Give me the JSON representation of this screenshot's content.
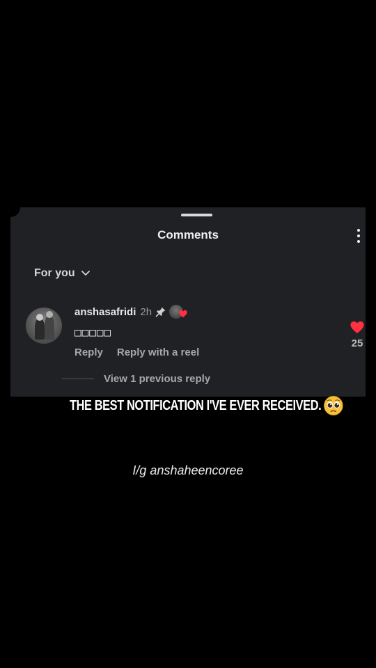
{
  "sheet": {
    "title": "Comments",
    "filter_label": "For you"
  },
  "comment": {
    "username": "anshasafridi",
    "time": "2h",
    "text": "□□□□□",
    "reply_label": "Reply",
    "reply_reel_label": "Reply with a reel",
    "like_count": "25",
    "view_replies_label": "View 1 previous reply"
  },
  "caption": {
    "text": "THE BEST NOTIFICATION I'VE EVER RECEIVED.",
    "emoji": "pleading-face-icon"
  },
  "credit": {
    "text": "I/g anshaheencoree"
  },
  "colors": {
    "sheet_bg": "#1f2124",
    "heart": "#ff3040",
    "background": "#000000"
  }
}
